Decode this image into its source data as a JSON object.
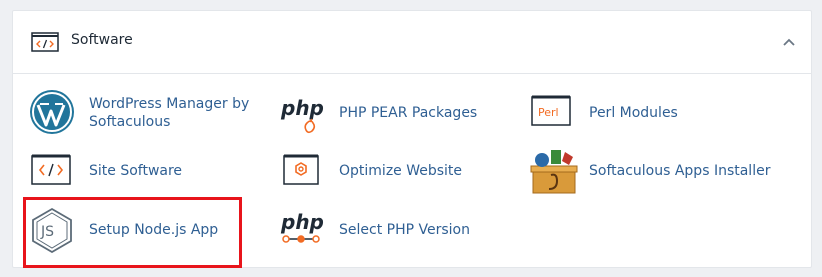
{
  "panel": {
    "title": "Software",
    "icon": "code-brackets-icon",
    "collapse_icon": "chevron-up-icon"
  },
  "items": [
    {
      "label_line1": "WordPress Manager by",
      "label_line2": "Softaculous",
      "icon": "wordpress-icon"
    },
    {
      "label": "PHP PEAR Packages",
      "icon": "php-pear-icon",
      "icon_text": "php"
    },
    {
      "label": "Perl Modules",
      "icon": "perl-icon",
      "icon_text": "Perl"
    },
    {
      "label": "Site Software",
      "icon": "code-brackets-icon"
    },
    {
      "label": "Optimize Website",
      "icon": "optimize-gear-icon"
    },
    {
      "label": "Softaculous Apps Installer",
      "icon": "softaculous-icon"
    },
    {
      "label": "Setup Node.js App",
      "icon": "nodejs-icon",
      "icon_text": "JS"
    },
    {
      "label": "Select PHP Version",
      "icon": "php-version-icon",
      "icon_text": "php"
    }
  ],
  "colors": {
    "link": "#2f5f93",
    "highlight": "#e8141b",
    "accent_orange": "#f26b23"
  }
}
